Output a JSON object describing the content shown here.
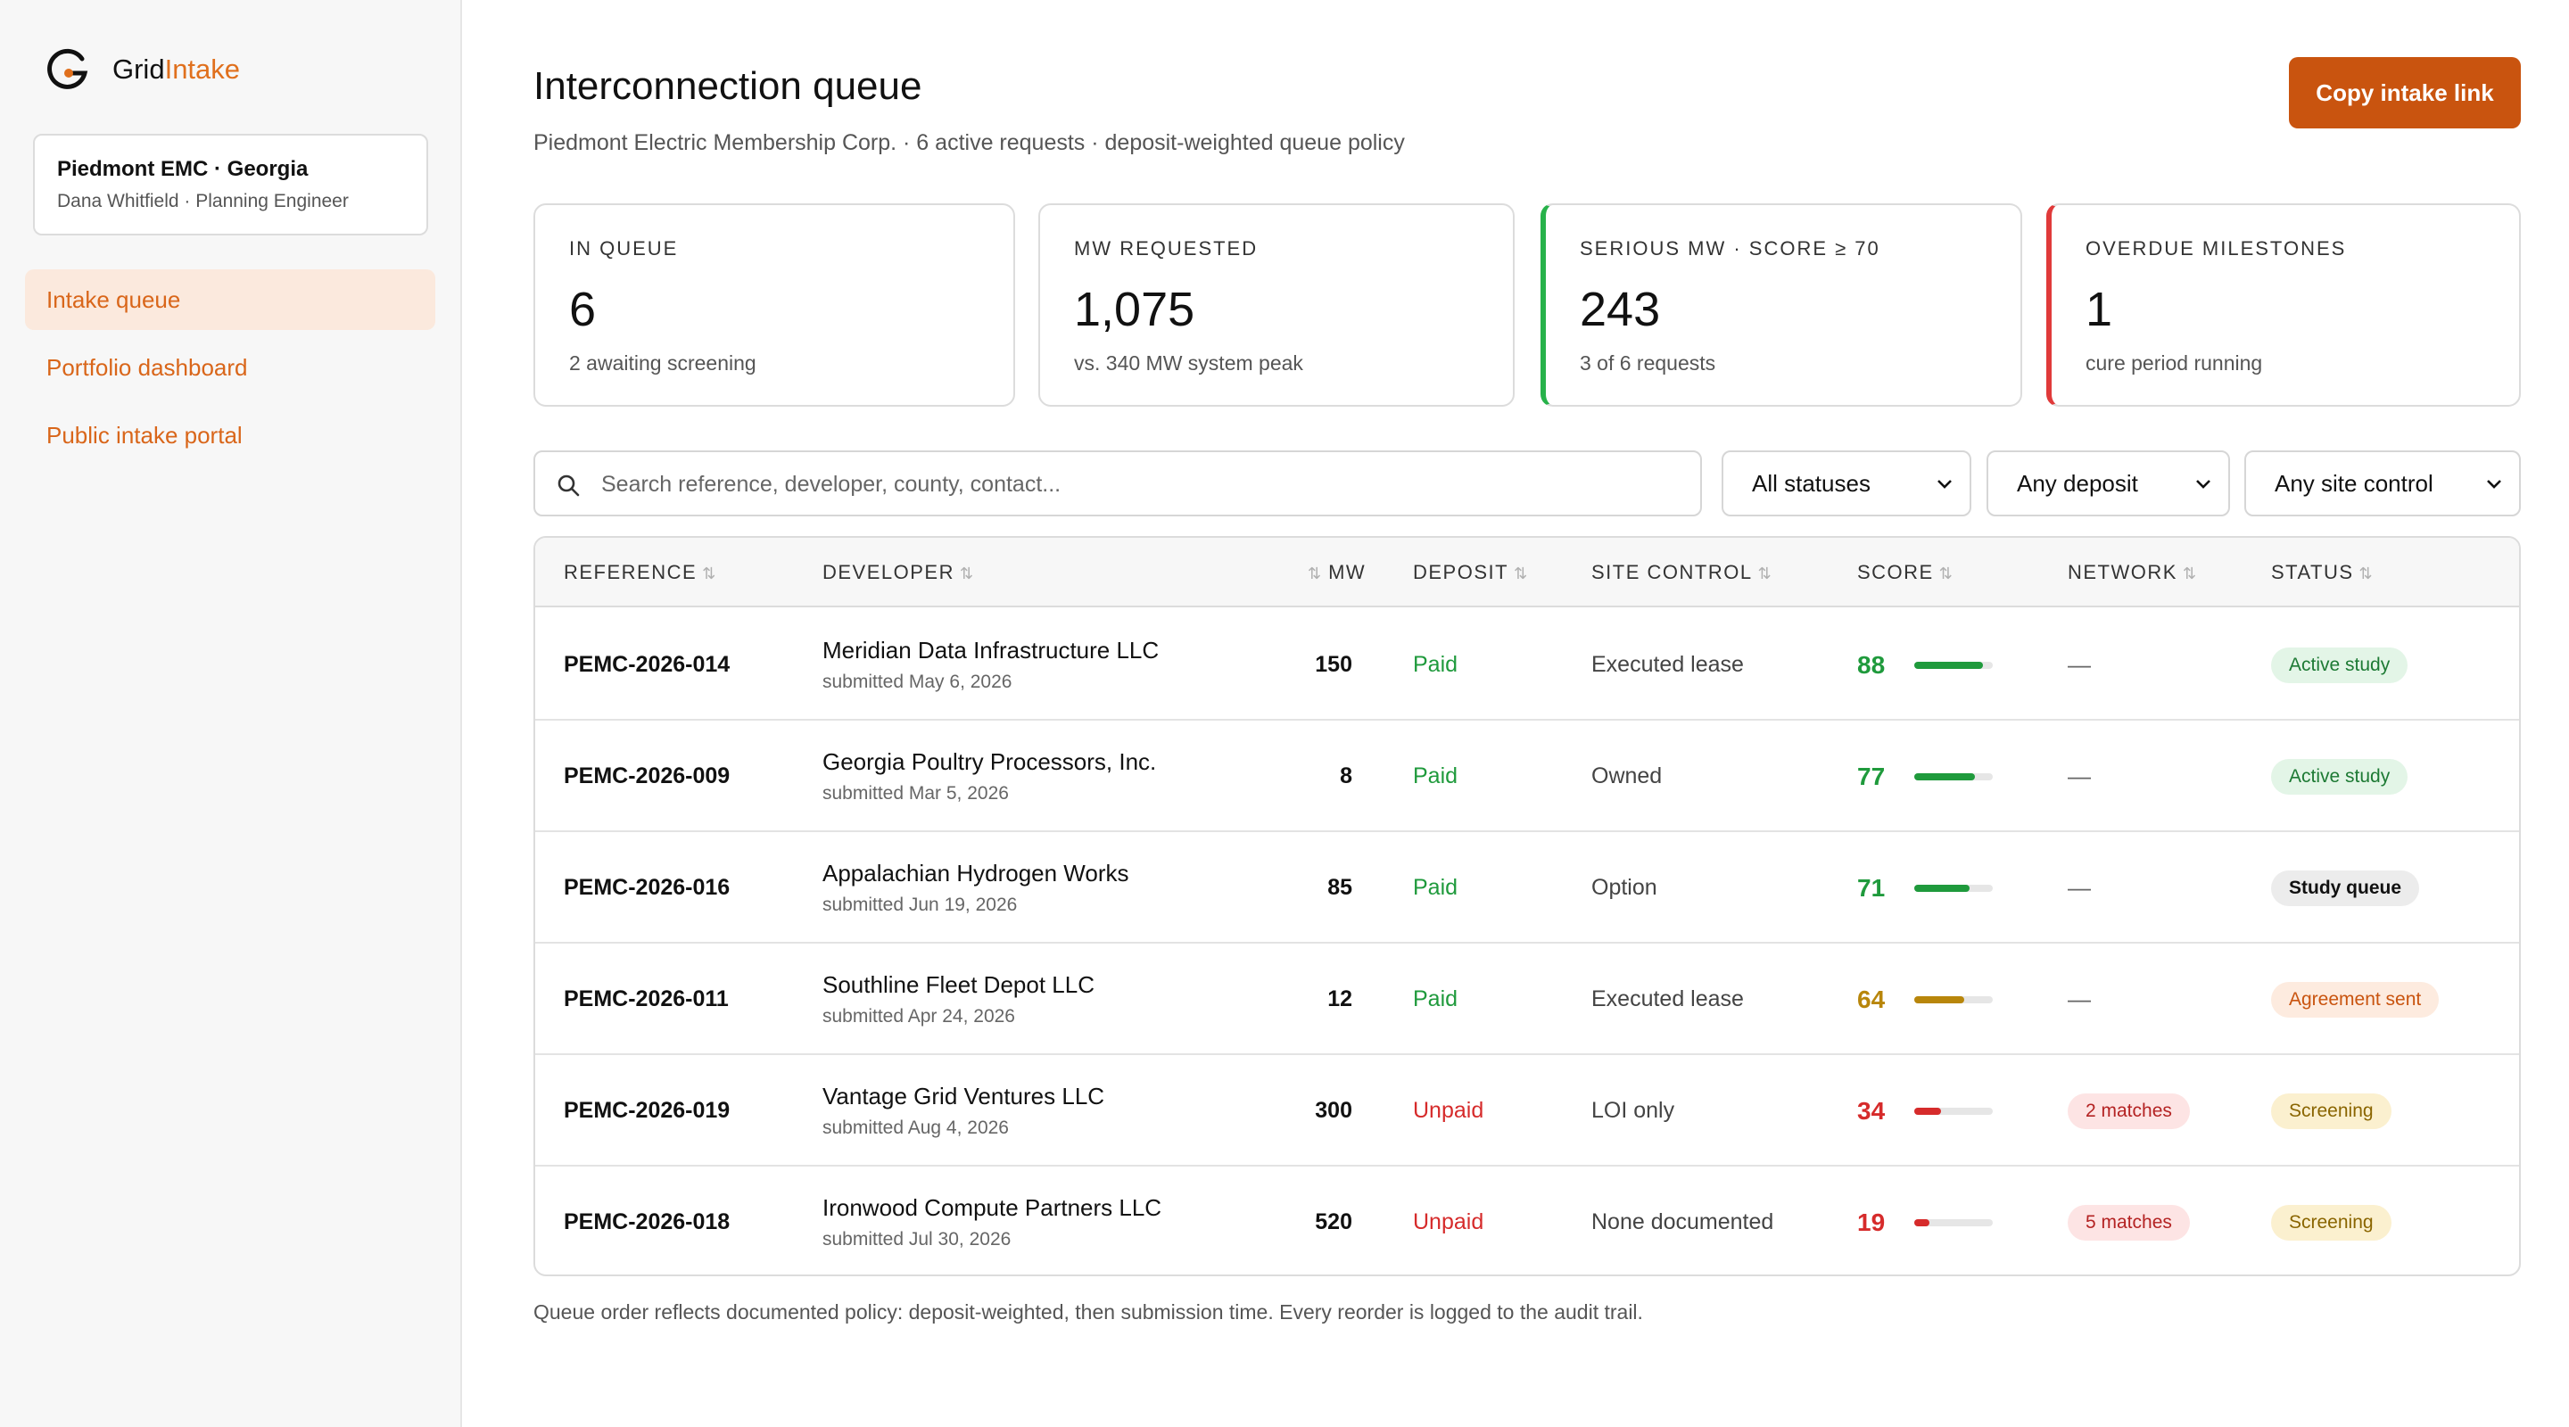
{
  "brand": {
    "name_part1": "Grid",
    "name_part2": "Intake",
    "logo_icon": "grid-intake-logo-icon"
  },
  "org": {
    "name": "Piedmont EMC · Georgia",
    "user": "Dana Whitfield · Planning Engineer"
  },
  "nav": [
    {
      "label": "Intake queue",
      "active": true
    },
    {
      "label": "Portfolio dashboard",
      "active": false
    },
    {
      "label": "Public intake portal",
      "active": false
    }
  ],
  "header": {
    "title": "Interconnection queue",
    "subtitle": "Piedmont Electric Membership Corp. · 6 active requests · deposit-weighted queue policy",
    "copy_button": "Copy intake link"
  },
  "stats": [
    {
      "label": "IN QUEUE",
      "value": "6",
      "note": "2 awaiting screening"
    },
    {
      "label": "MW REQUESTED",
      "value": "1,075",
      "note": "vs. 340 MW system peak"
    },
    {
      "label": "SERIOUS MW · SCORE ≥ 70",
      "value": "243",
      "note": "3 of 6 requests"
    },
    {
      "label": "OVERDUE MILESTONES",
      "value": "1",
      "note": "cure period running"
    }
  ],
  "filters": {
    "search_placeholder": "Search reference, developer, county, contact...",
    "status": "All statuses",
    "deposit": "Any deposit",
    "site_control": "Any site control"
  },
  "table": {
    "columns": [
      "REFERENCE",
      "DEVELOPER",
      "MW",
      "DEPOSIT",
      "SITE CONTROL",
      "SCORE",
      "NETWORK",
      "STATUS"
    ],
    "rows": [
      {
        "ref": "PEMC-2026-014",
        "developer": "Meridian Data Infrastructure LLC",
        "submitted": "submitted May 6, 2026",
        "mw": "150",
        "deposit": "Paid",
        "site": "Executed lease",
        "score": "88",
        "network": "—",
        "status": "Active study"
      },
      {
        "ref": "PEMC-2026-009",
        "developer": "Georgia Poultry Processors, Inc.",
        "submitted": "submitted Mar 5, 2026",
        "mw": "8",
        "deposit": "Paid",
        "site": "Owned",
        "score": "77",
        "network": "—",
        "status": "Active study"
      },
      {
        "ref": "PEMC-2026-016",
        "developer": "Appalachian Hydrogen Works",
        "submitted": "submitted Jun 19, 2026",
        "mw": "85",
        "deposit": "Paid",
        "site": "Option",
        "score": "71",
        "network": "—",
        "status": "Study queue"
      },
      {
        "ref": "PEMC-2026-011",
        "developer": "Southline Fleet Depot LLC",
        "submitted": "submitted Apr 24, 2026",
        "mw": "12",
        "deposit": "Paid",
        "site": "Executed lease",
        "score": "64",
        "network": "—",
        "status": "Agreement sent"
      },
      {
        "ref": "PEMC-2026-019",
        "developer": "Vantage Grid Ventures LLC",
        "submitted": "submitted Aug 4, 2026",
        "mw": "300",
        "deposit": "Unpaid",
        "site": "LOI only",
        "score": "34",
        "network": "2 matches",
        "status": "Screening"
      },
      {
        "ref": "PEMC-2026-018",
        "developer": "Ironwood Compute Partners LLC",
        "submitted": "submitted Jul 30, 2026",
        "mw": "520",
        "deposit": "Unpaid",
        "site": "None documented",
        "score": "19",
        "network": "5 matches",
        "status": "Screening"
      }
    ]
  },
  "footer_note": "Queue order reflects documented policy: deposit-weighted, then submission time. Every reorder is logged to the audit trail.",
  "colors": {
    "accent": "#e0701d",
    "button": "#c9540f",
    "score_high": "#1f9a3c",
    "score_mid": "#b8860b",
    "score_low": "#d62b2b"
  }
}
